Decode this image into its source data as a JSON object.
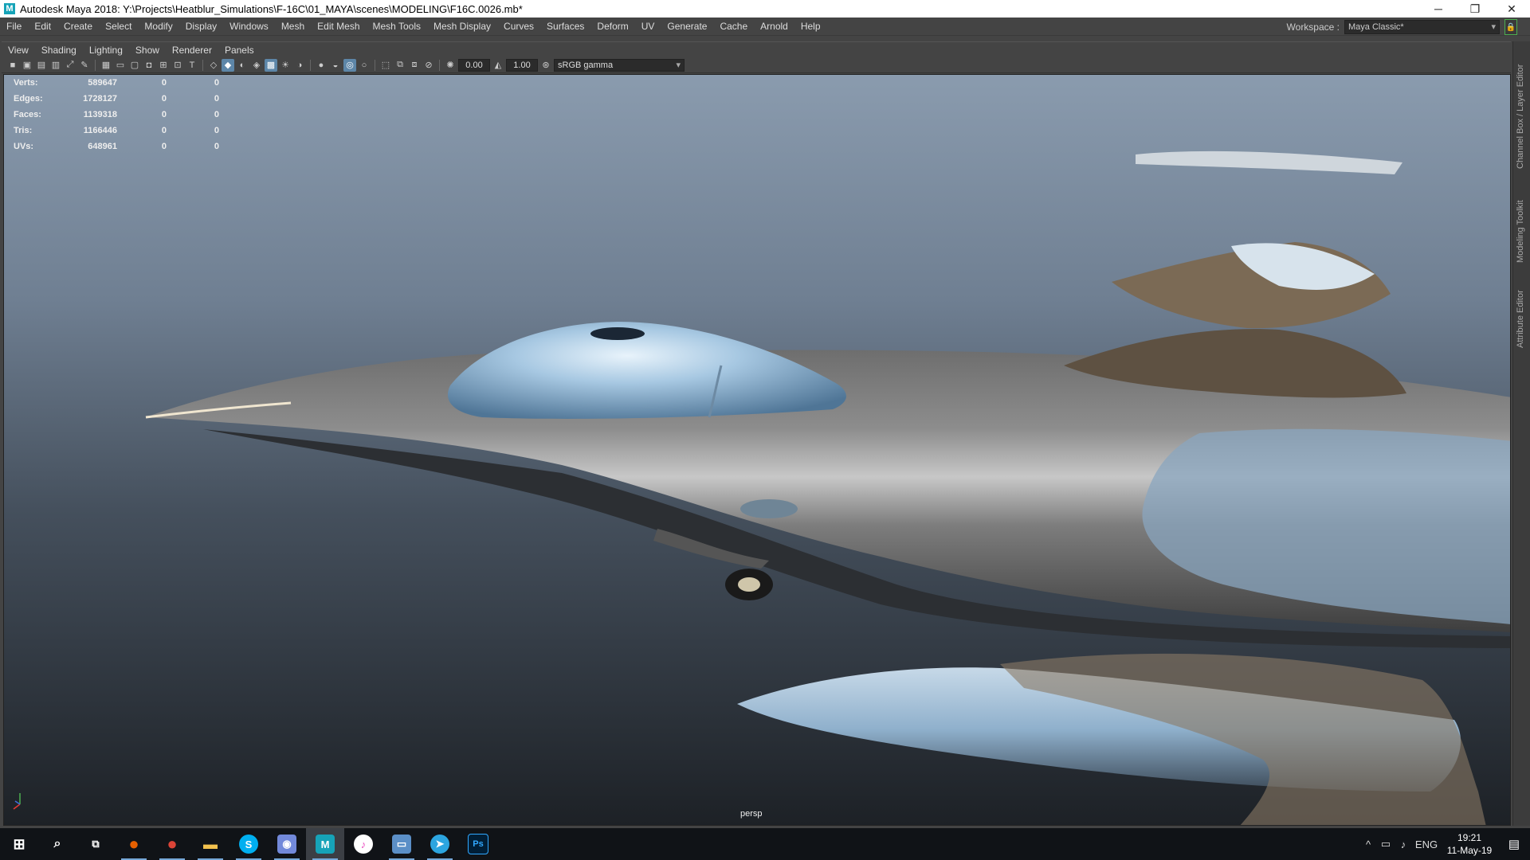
{
  "window": {
    "title": "Autodesk Maya 2018: Y:\\Projects\\Heatblur_Simulations\\F-16C\\01_MAYA\\scenes\\MODELING\\F16C.0026.mb*",
    "app_icon": "M",
    "minimize": "─",
    "maximize": "❐",
    "close": "✕"
  },
  "menubar": {
    "items": [
      "File",
      "Edit",
      "Create",
      "Select",
      "Modify",
      "Display",
      "Windows",
      "Mesh",
      "Edit Mesh",
      "Mesh Tools",
      "Mesh Display",
      "Curves",
      "Surfaces",
      "Deform",
      "UV",
      "Generate",
      "Cache",
      "Arnold",
      "Help"
    ],
    "workspace_label": "Workspace :",
    "workspace_value": "Maya Classic*"
  },
  "panel_menu": {
    "items": [
      "View",
      "Shading",
      "Lighting",
      "Show",
      "Renderer",
      "Panels"
    ]
  },
  "toolbar": {
    "exposure": "0.00",
    "gamma": "1.00",
    "color_space": "sRGB gamma"
  },
  "hud": {
    "rows": [
      {
        "label": "Verts:",
        "v1": "589647",
        "v2": "0",
        "v3": "0"
      },
      {
        "label": "Edges:",
        "v1": "1728127",
        "v2": "0",
        "v3": "0"
      },
      {
        "label": "Faces:",
        "v1": "1139318",
        "v2": "0",
        "v3": "0"
      },
      {
        "label": "Tris:",
        "v1": "1166446",
        "v2": "0",
        "v3": "0"
      },
      {
        "label": "UVs:",
        "v1": "648961",
        "v2": "0",
        "v3": "0"
      }
    ]
  },
  "viewport": {
    "camera": "persp"
  },
  "side_tabs": [
    "Channel Box / Layer Editor",
    "Modeling Toolkit",
    "Attribute Editor"
  ],
  "taskbar": {
    "language": "ENG",
    "time": "19:21",
    "date": "11-May-19",
    "apps": [
      {
        "name": "firefox",
        "glyph": "●",
        "color": "#e66000"
      },
      {
        "name": "chrome",
        "glyph": "●",
        "color": "#db4437"
      },
      {
        "name": "file-explorer",
        "glyph": "▬",
        "color": "#f2c14e"
      },
      {
        "name": "skype",
        "glyph": "S",
        "color": "#00aff0"
      },
      {
        "name": "discord",
        "glyph": "◉",
        "color": "#7289da"
      },
      {
        "name": "maya",
        "glyph": "M",
        "color": "#16a3b8"
      },
      {
        "name": "itunes",
        "glyph": "♪",
        "color": "#ea4cc0"
      },
      {
        "name": "window-app",
        "glyph": "▭",
        "color": "#5b8fc7"
      },
      {
        "name": "telegram",
        "glyph": "➤",
        "color": "#2ca5e0"
      },
      {
        "name": "photoshop",
        "glyph": "Ps",
        "color": "#31a8ff"
      }
    ]
  }
}
